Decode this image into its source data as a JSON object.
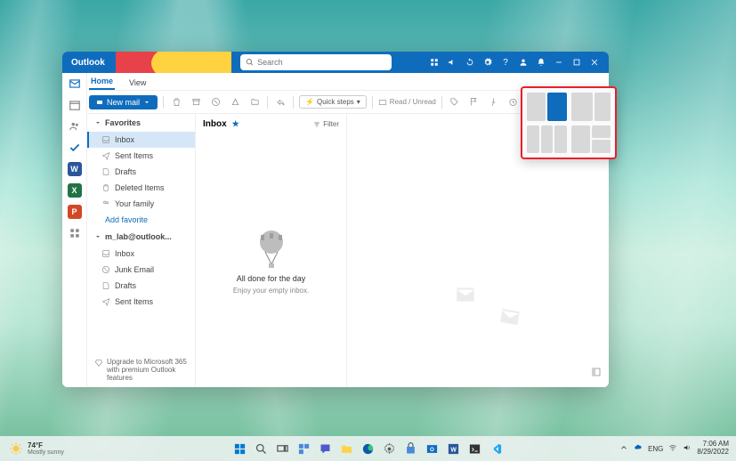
{
  "app": {
    "name": "Outlook"
  },
  "search": {
    "placeholder": "Search"
  },
  "titlebar_icons": [
    "grid-icon",
    "megaphone-icon",
    "sync-icon",
    "settings-icon",
    "help-icon",
    "person-icon",
    "notifications-icon",
    "minimize-icon",
    "maximize-icon",
    "close-icon"
  ],
  "ribbon": {
    "tabs": [
      {
        "label": "Home",
        "active": true
      },
      {
        "label": "View",
        "active": false
      }
    ],
    "new_mail": "New mail",
    "quick_steps": "Quick steps",
    "read_unread": "Read / Unread"
  },
  "apprail": [
    "mail",
    "calendar",
    "people",
    "todo",
    "word",
    "excel",
    "powerpoint",
    "more-apps"
  ],
  "nav": {
    "favorites_label": "Favorites",
    "favorites": [
      {
        "icon": "inbox-icon",
        "label": "Inbox",
        "active": true
      },
      {
        "icon": "sent-icon",
        "label": "Sent Items"
      },
      {
        "icon": "draft-icon",
        "label": "Drafts"
      },
      {
        "icon": "delete-icon",
        "label": "Deleted Items"
      },
      {
        "icon": "group-icon",
        "label": "Your family"
      }
    ],
    "add_favorite": "Add favorite",
    "account_label": "m_lab@outlook...",
    "account_folders": [
      {
        "icon": "inbox-icon",
        "label": "Inbox"
      },
      {
        "icon": "junk-icon",
        "label": "Junk Email"
      },
      {
        "icon": "draft-icon",
        "label": "Drafts"
      },
      {
        "icon": "sent-icon",
        "label": "Sent Items"
      }
    ],
    "upgrade": "Upgrade to Microsoft 365 with premium Outlook features"
  },
  "list": {
    "title": "Inbox",
    "filter": "Filter",
    "empty_title": "All done for the day",
    "empty_sub": "Enjoy your empty inbox."
  },
  "taskbar": {
    "weather_temp": "74°F",
    "weather_desc": "Mostly sunny",
    "lang": "ENG",
    "time": "7:06 AM",
    "date": "8/29/2022"
  }
}
